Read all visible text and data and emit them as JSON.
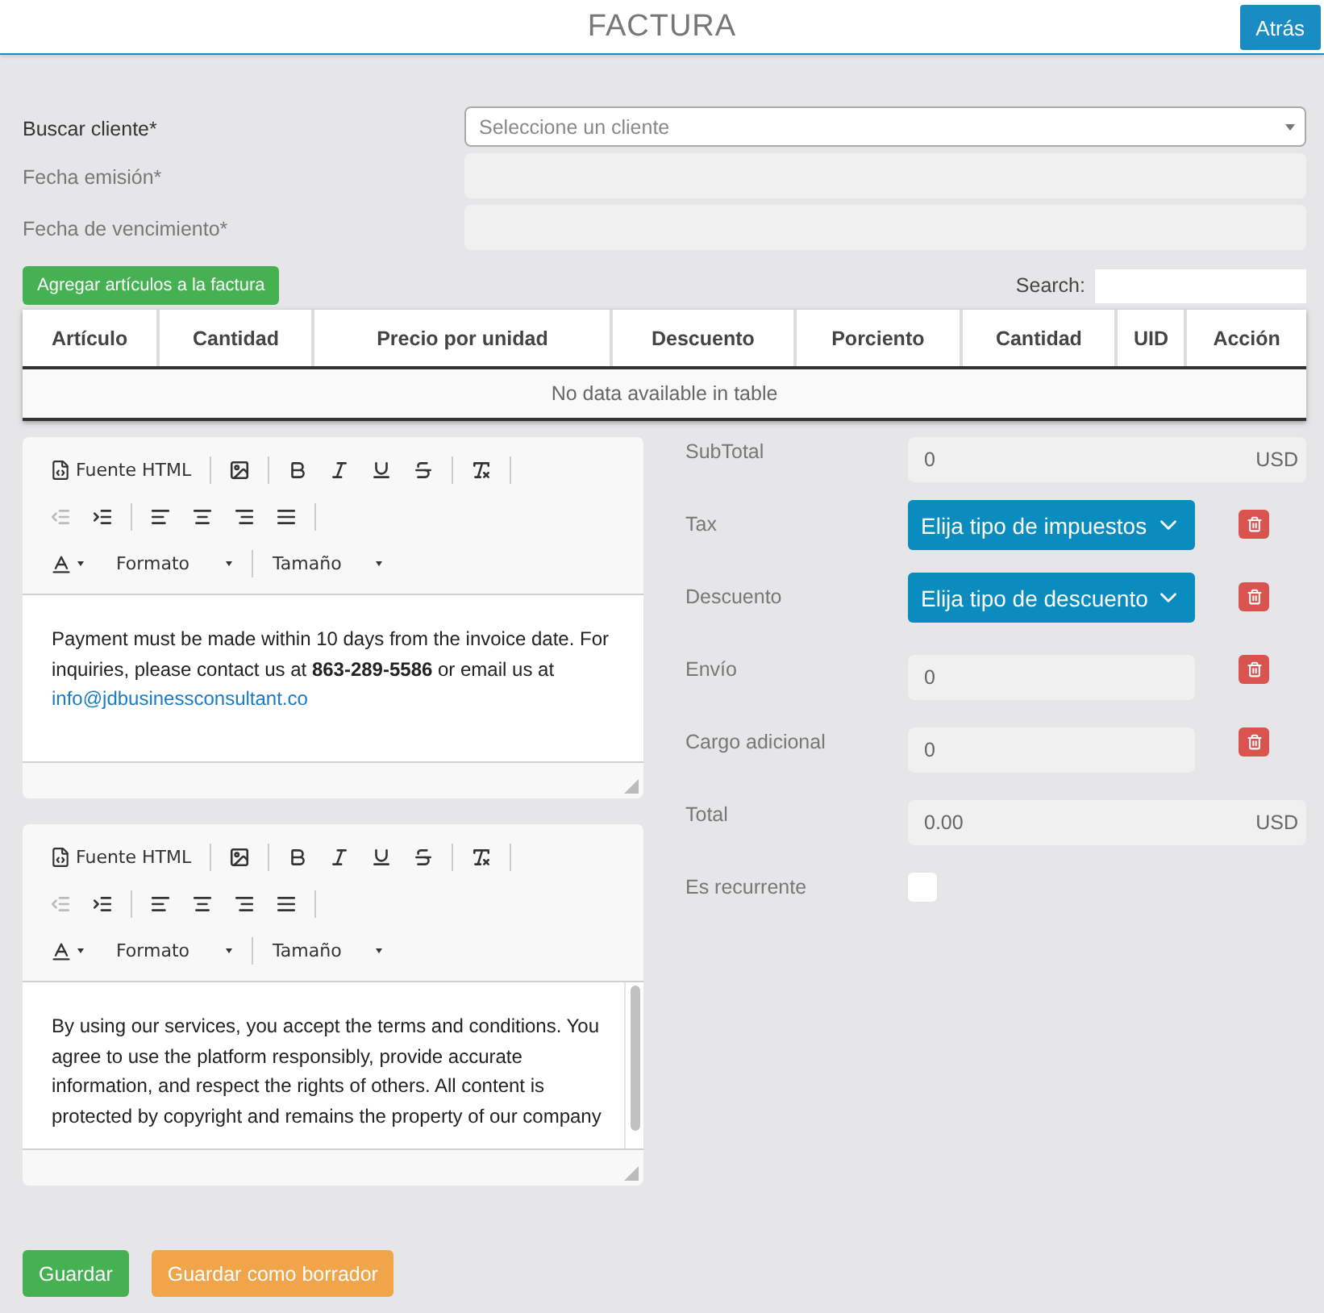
{
  "header": {
    "title": "FACTURA",
    "back_button": "Atrás"
  },
  "fields": [
    {
      "kind": "select",
      "label": "Buscar cliente*",
      "placeholder": "Seleccione un cliente"
    },
    {
      "kind": "input",
      "label": "Fecha emisión*"
    },
    {
      "kind": "input",
      "label": "Fecha de vencimiento*"
    }
  ],
  "add_items_button": "Agregar artículos a la factura",
  "table": {
    "search_label": "Search:",
    "columns": [
      "Artículo",
      "Cantidad",
      "Precio por unidad",
      "Descuento",
      "Porciento",
      "Cantidad",
      "UID",
      "Acción"
    ],
    "empty_message": "No data available in table"
  },
  "editors": [
    {
      "toolbar": {
        "source_label": "Fuente HTML",
        "format": "Formato",
        "size": "Tamaño"
      },
      "text": "Payment must be made within 10 days from the invoice date. For inquiries, please contact us at **863-289-5586** or email us at",
      "link": "info@jdbusinessconsultant.co",
      "scrollbar": false
    },
    {
      "toolbar": {
        "source_label": "Fuente HTML",
        "format": "Formato",
        "size": "Tamaño"
      },
      "text": "By using our services, you accept the terms and conditions. You agree to use the platform responsibly, provide accurate information, and respect the rights of others. All content is protected by copyright and remains the property of our company",
      "scrollbar": true
    }
  ],
  "totals": [
    {
      "kind": "amount",
      "label": "SubTotal",
      "value": "0",
      "currency": "USD"
    },
    {
      "kind": "dropdown",
      "label": "Tax",
      "value": "Elija tipo de impuestos",
      "removable": true
    },
    {
      "kind": "dropdown",
      "label": "Descuento",
      "value": "Elija tipo de descuento",
      "removable": true
    },
    {
      "kind": "input",
      "label": "Envío",
      "value": "0",
      "removable": true
    },
    {
      "kind": "input",
      "label": "Cargo adicional",
      "value": "0",
      "removable": true
    },
    {
      "kind": "amount",
      "label": "Total",
      "value": "0.00",
      "currency": "USD"
    },
    {
      "kind": "checkbox",
      "label": "Es recurrente",
      "checked": false
    }
  ],
  "actions": [
    {
      "kind": "save",
      "label": "Guardar"
    },
    {
      "kind": "draft",
      "label": "Guardar como borrador"
    }
  ]
}
